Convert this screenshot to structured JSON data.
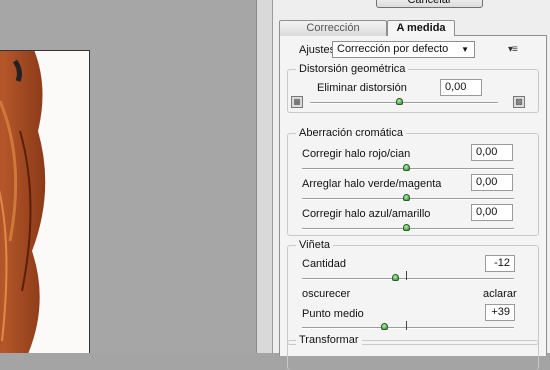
{
  "dialog": {
    "cancel_label": "Cancelar"
  },
  "tabs": [
    {
      "label": "Corrección automática",
      "active": false
    },
    {
      "label": "A medida",
      "active": true
    }
  ],
  "settings": {
    "label": "Ajustes:",
    "value": "Corrección por defecto"
  },
  "distortion": {
    "title": "Distorsión geométrica",
    "remove_label": "Eliminar distorsión",
    "remove_value": "0,00",
    "slider_position": 0.5
  },
  "chromatic": {
    "title": "Aberración cromática",
    "rows": [
      {
        "label": "Corregir halo rojo/cian",
        "value": "0,00",
        "slider_position": 0.5
      },
      {
        "label": "Arreglar halo verde/magenta",
        "value": "0,00",
        "slider_position": 0.5
      },
      {
        "label": "Corregir halo azul/amarillo",
        "value": "0,00",
        "slider_position": 0.5
      }
    ]
  },
  "vignette": {
    "title": "Viñeta",
    "amount_label": "Cantidad",
    "amount_value": "-12",
    "amount_position": 0.44,
    "darken_label": "oscurecer",
    "lighten_label": "aclarar",
    "midpoint_label": "Punto medio",
    "midpoint_value": "+39",
    "midpoint_position": 0.39
  },
  "transform": {
    "title": "Transformar"
  },
  "colors": {
    "panel_bg": "#f4f4f4",
    "thumb": "#2a8a3a",
    "preview_bg": "#a6a6a6"
  }
}
